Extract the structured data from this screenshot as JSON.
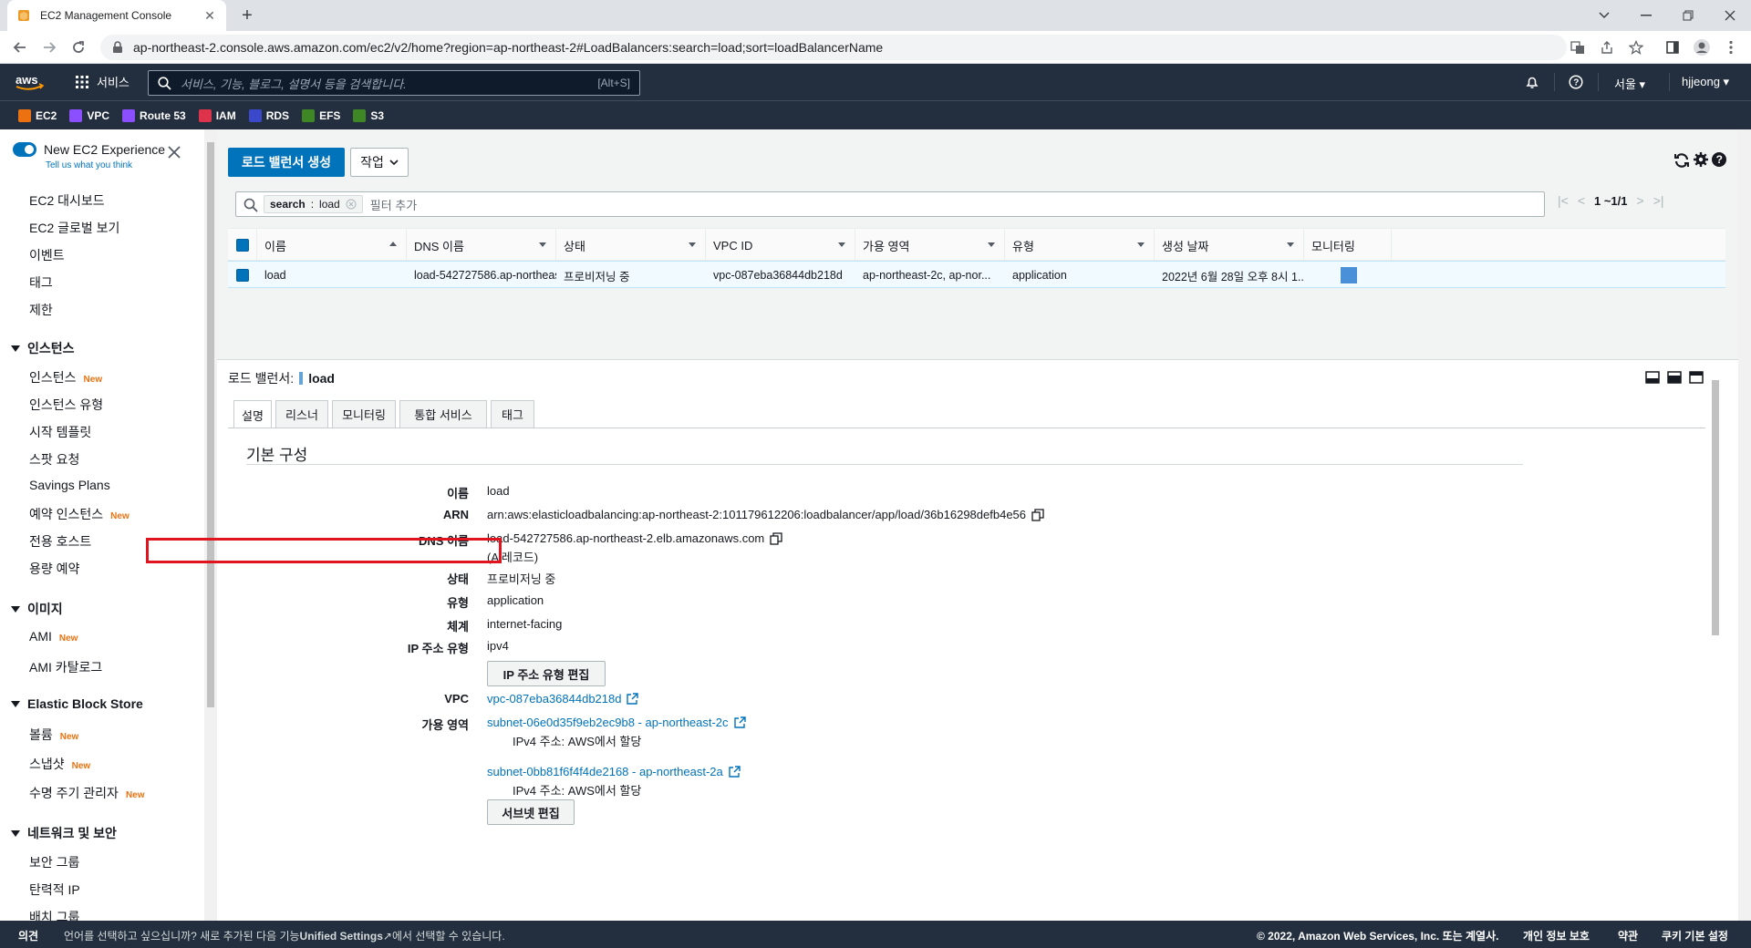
{
  "browser": {
    "tab_title": "EC2 Management Console",
    "url": "ap-northeast-2.console.aws.amazon.com/ec2/v2/home?region=ap-northeast-2#LoadBalancers:search=load;sort=loadBalancerName"
  },
  "header": {
    "services_label": "서비스",
    "search_placeholder": "서비스, 기능, 블로그, 설명서 등을 검색합니다.",
    "search_shortcut": "[Alt+S]",
    "region": "서울",
    "user": "hjjeong"
  },
  "favorites": [
    {
      "label": "EC2",
      "color": "#ec7211"
    },
    {
      "label": "VPC",
      "color": "#8c4fff"
    },
    {
      "label": "Route 53",
      "color": "#8c4fff"
    },
    {
      "label": "IAM",
      "color": "#dd344c"
    },
    {
      "label": "RDS",
      "color": "#3b48cc"
    },
    {
      "label": "EFS",
      "color": "#3f8624"
    },
    {
      "label": "S3",
      "color": "#3f8624"
    }
  ],
  "sidebar": {
    "experience_title": "New EC2 Experience",
    "experience_sub": "Tell us what you think",
    "top_items": [
      "EC2 대시보드",
      "EC2 글로벌 보기",
      "이벤트",
      "태그",
      "제한"
    ],
    "sections": [
      {
        "title": "인스턴스",
        "items": [
          {
            "label": "인스턴스",
            "badge": "New"
          },
          {
            "label": "인스턴스 유형",
            "badge": ""
          },
          {
            "label": "시작 템플릿",
            "badge": ""
          },
          {
            "label": "스팟 요청",
            "badge": ""
          },
          {
            "label": "Savings Plans",
            "badge": ""
          },
          {
            "label": "예약 인스턴스",
            "badge": "New"
          },
          {
            "label": "전용 호스트",
            "badge": ""
          },
          {
            "label": "용량 예약",
            "badge": ""
          }
        ]
      },
      {
        "title": "이미지",
        "items": [
          {
            "label": "AMI",
            "badge": "New"
          },
          {
            "label": "AMI 카탈로그",
            "badge": ""
          }
        ]
      },
      {
        "title": "Elastic Block Store",
        "items": [
          {
            "label": "볼륨",
            "badge": "New"
          },
          {
            "label": "스냅샷",
            "badge": "New"
          },
          {
            "label": "수명 주기 관리자",
            "badge": "New"
          }
        ]
      },
      {
        "title": "네트워크 및 보안",
        "items": [
          {
            "label": "보안 그룹",
            "badge": ""
          },
          {
            "label": "탄력적 IP",
            "badge": ""
          },
          {
            "label": "배치 그룹",
            "badge": ""
          }
        ]
      }
    ]
  },
  "toolbar": {
    "create_label": "로드 밸런서 생성",
    "actions_label": "작업"
  },
  "filter": {
    "token_key": "search",
    "token_value": "load",
    "placeholder": "필터 추가",
    "pager": "1 ~1/1"
  },
  "table": {
    "columns": [
      "이름",
      "DNS 이름",
      "상태",
      "VPC ID",
      "가용 영역",
      "유형",
      "생성 날짜",
      "모니터링"
    ],
    "row": {
      "name": "load",
      "dns": "load-542727586.ap-northeas...",
      "state": "프로비저닝 중",
      "vpc": "vpc-087eba36844db218d",
      "az": "ap-northeast-2c, ap-nor...",
      "type": "application",
      "created": "2022년 6월 28일 오후 8시 1..."
    }
  },
  "details": {
    "title_prefix": "로드 밸런서:",
    "title_name": "load",
    "tabs": [
      "설명",
      "리스너",
      "모니터링",
      "통합 서비스",
      "태그"
    ],
    "section_title": "기본 구성",
    "labels": {
      "name": "이름",
      "arn": "ARN",
      "dns": "DNS 이름",
      "state": "상태",
      "type": "유형",
      "scheme": "체계",
      "ip_type": "IP 주소 유형",
      "vpc": "VPC",
      "az": "가용 영역"
    },
    "values": {
      "name": "load",
      "arn": "arn:aws:elasticloadbalancing:ap-northeast-2:101179612206:loadbalancer/app/load/36b16298defb4e56",
      "dns": "load-542727586.ap-northeast-2.elb.amazonaws.com",
      "dns_note": "(A 레코드)",
      "state": "프로비저닝 중",
      "type": "application",
      "scheme": "internet-facing",
      "ip_type": "ipv4",
      "ip_edit_btn": "IP 주소 유형 편집",
      "vpc": "vpc-087eba36844db218d",
      "subnet1": "subnet-06e0d35f9eb2ec9b8 - ap-northeast-2c",
      "subnet1_ip": "IPv4 주소: AWS에서 할당",
      "subnet2": "subnet-0bb81f6f4f4de2168 - ap-northeast-2a",
      "subnet2_ip": "IPv4 주소: AWS에서 할당",
      "subnet_edit_btn": "서브넷 편집"
    }
  },
  "footer": {
    "feedback": "의견",
    "lang_prefix": "언어를 선택하고 싶으십니까? 새로 추가된 다음 기능",
    "lang_link": "Unified Settings",
    "lang_suffix": "에서 선택할 수 있습니다.",
    "copyright": "© 2022, Amazon Web Services, Inc. 또는 계열사.",
    "privacy": "개인 정보 보호",
    "terms": "약관",
    "cookies": "쿠키 기본 설정"
  }
}
